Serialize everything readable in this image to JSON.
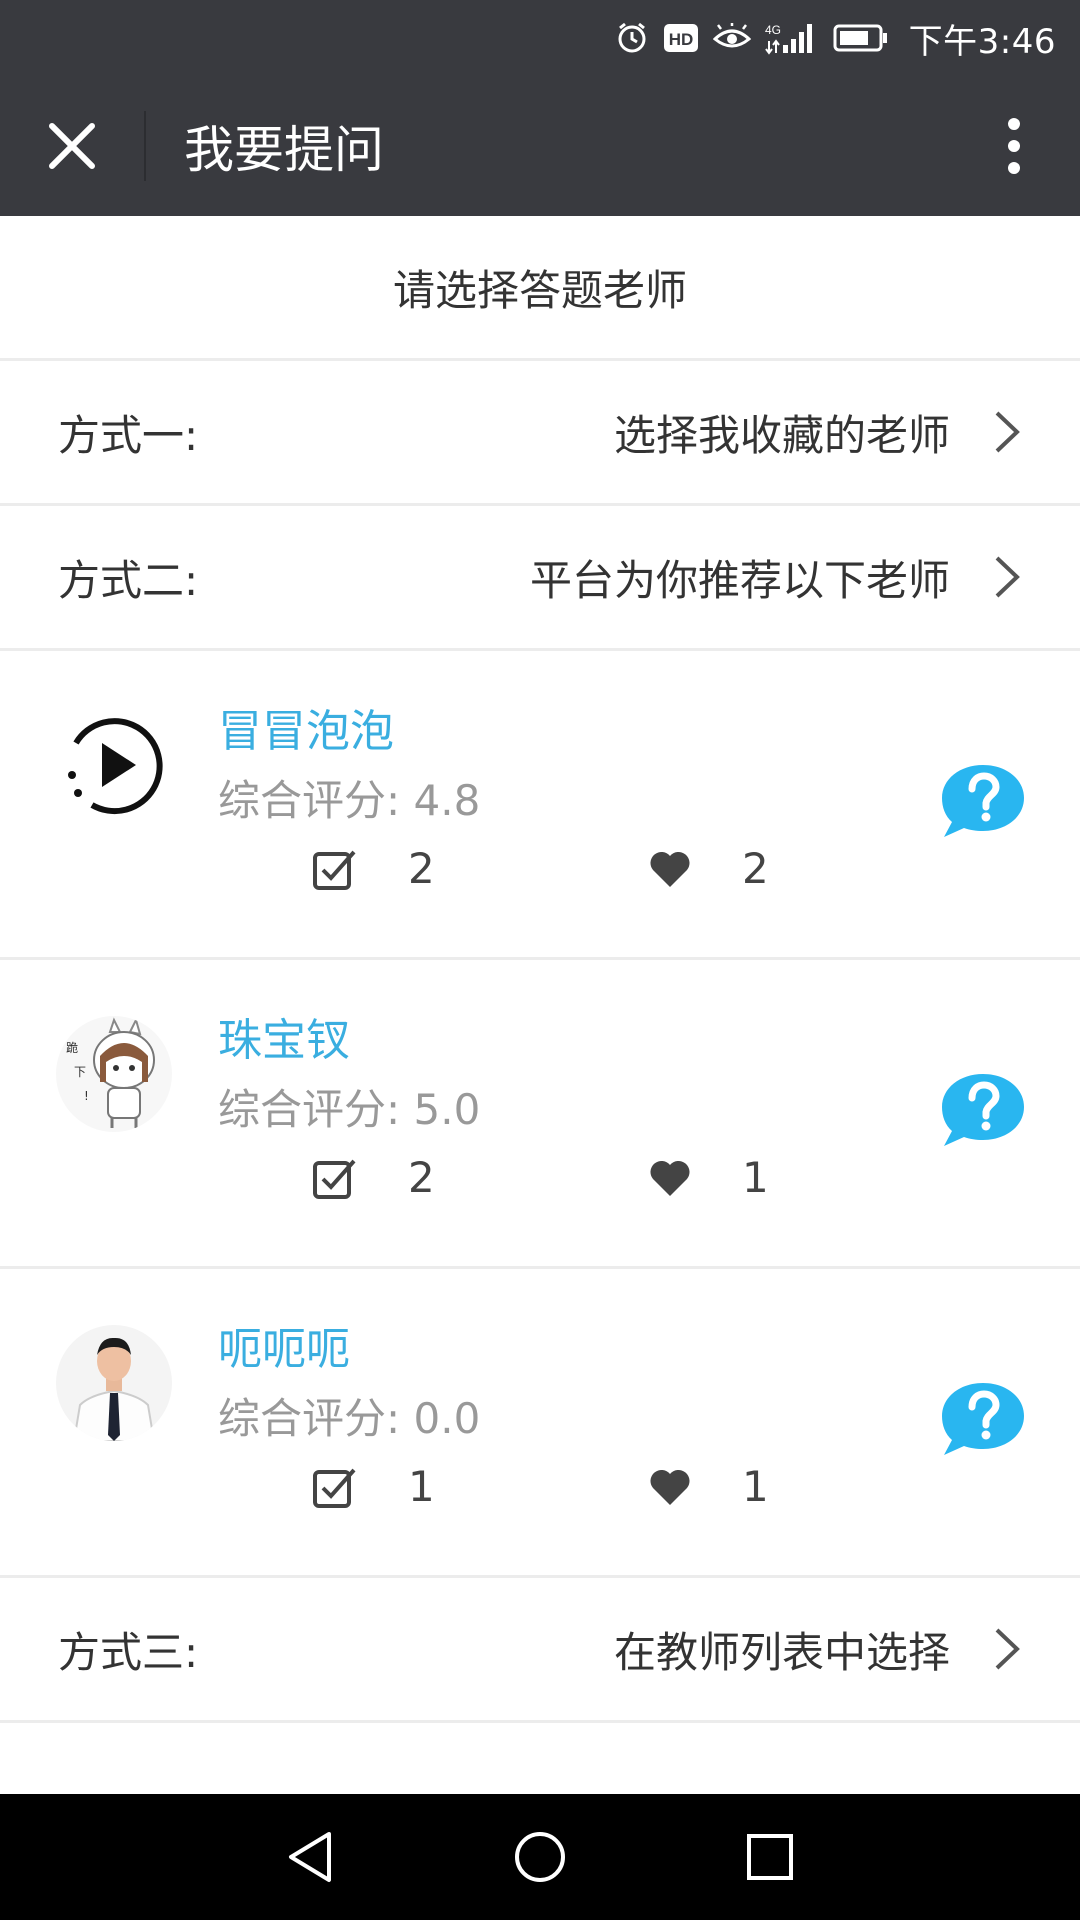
{
  "status_bar": {
    "time": "下午3:46",
    "icons": [
      "alarm-icon",
      "hd-icon",
      "eye-icon",
      "signal-4g-icon",
      "battery-icon"
    ],
    "hd_text": "HD",
    "network_text": "4G"
  },
  "title_bar": {
    "title": "我要提问",
    "close_icon": "close-icon",
    "more_icon": "more-vertical-icon"
  },
  "section_header": "请选择答题老师",
  "options": [
    {
      "label": "方式一:",
      "value": "选择我收藏的老师"
    },
    {
      "label": "方式二:",
      "value": "平台为你推荐以下老师"
    },
    {
      "label": "方式三:",
      "value": "在教师列表中选择"
    }
  ],
  "teachers": [
    {
      "name": "冒冒泡泡",
      "rating_label": "综合评分: 4.8",
      "answers": "2",
      "likes": "2",
      "avatar": "play-circle-avatar"
    },
    {
      "name": "珠宝钗",
      "rating_label": "综合评分: 5.0",
      "answers": "2",
      "likes": "1",
      "avatar": "cartoon-girl-avatar"
    },
    {
      "name": "呃呃呃",
      "rating_label": "综合评分: 0.0",
      "answers": "1",
      "likes": "1",
      "avatar": "man-in-tie-avatar"
    }
  ],
  "colors": {
    "title_bar": "#393a3f",
    "accent_name": "#3aaee0",
    "ask_button": "#29b6f0",
    "divider": "#ececec"
  },
  "nav_bar": {
    "icons": [
      "back-icon",
      "home-icon",
      "recents-icon"
    ]
  }
}
